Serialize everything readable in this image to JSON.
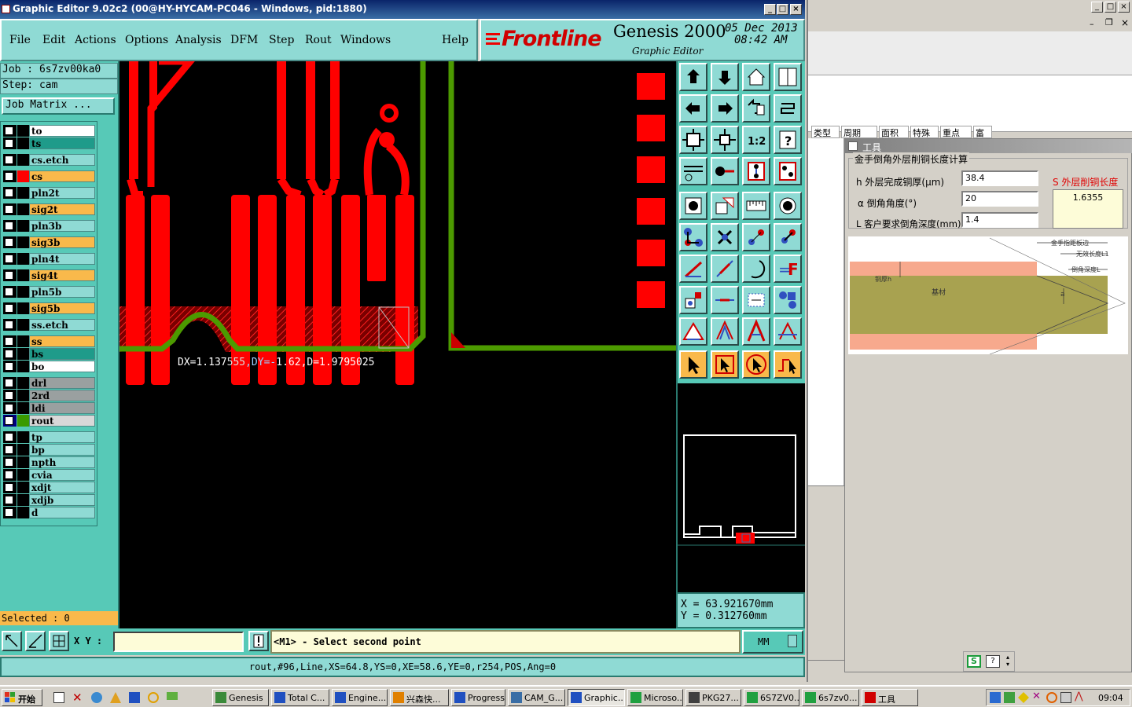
{
  "window": {
    "title": "Graphic Editor 9.02c2 (00@HY-HYCAM-PC046 - Windows, pid:1880)"
  },
  "menu": [
    "File",
    "Edit",
    "Actions",
    "Options",
    "Analysis",
    "DFM",
    "Step",
    "Rout",
    "Windows"
  ],
  "help": "Help",
  "logo": {
    "brand": "Frontline",
    "product": "Genesis 2000",
    "subtitle": "Graphic Editor",
    "date": "05 Dec 2013",
    "time": "08:42  AM"
  },
  "job": {
    "job_label": "Job  :  6s7zv00ka0",
    "step_label": "Step:  cam",
    "matrix_button": "Job Matrix ..."
  },
  "layers": [
    {
      "name": "to",
      "color": "#ffffff"
    },
    {
      "name": "ts",
      "color": "#1f9b8a"
    },
    {
      "name": "cs.etch",
      "color": "#8fdad4"
    },
    {
      "name": "cs",
      "color": "#f9b94b"
    },
    {
      "name": "pln2t",
      "color": "#8fdad4"
    },
    {
      "name": "sig2t",
      "color": "#f9b94b"
    },
    {
      "name": "pln3b",
      "color": "#8fdad4"
    },
    {
      "name": "sig3b",
      "color": "#f9b94b"
    },
    {
      "name": "pln4t",
      "color": "#8fdad4"
    },
    {
      "name": "sig4t",
      "color": "#f9b94b"
    },
    {
      "name": "pln5b",
      "color": "#8fdad4"
    },
    {
      "name": "sig5b",
      "color": "#f9b94b"
    },
    {
      "name": "ss.etch",
      "color": "#8fdad4"
    },
    {
      "name": "ss",
      "color": "#f9b94b"
    },
    {
      "name": "bs",
      "color": "#1f9b8a"
    },
    {
      "name": "bo",
      "color": "#ffffff"
    },
    {
      "name": "drl",
      "color": "#9aa0a0"
    },
    {
      "name": "2rd",
      "color": "#9aa0a0"
    },
    {
      "name": "ldi",
      "color": "#9aa0a0"
    },
    {
      "name": "rout",
      "color": "#d8d8d8"
    },
    {
      "name": "tp",
      "color": "#8fdad4"
    },
    {
      "name": "bp",
      "color": "#8fdad4"
    },
    {
      "name": "npth",
      "color": "#8fdad4"
    },
    {
      "name": "cvia",
      "color": "#8fdad4"
    },
    {
      "name": "xdjt",
      "color": "#8fdad4"
    },
    {
      "name": "xdjb",
      "color": "#8fdad4"
    },
    {
      "name": "d",
      "color": "#8fdad4"
    }
  ],
  "selected": "Selected : 0",
  "canvas": {
    "measure_parts": [
      "DX=1.137",
      "555",
      ",DY=-",
      "1.62",
      ",D=",
      "1.9795025"
    ]
  },
  "coords": {
    "x": "X  =  63.921670mm",
    "y": "Y  =  0.312760mm"
  },
  "bottombar": {
    "xy_label": "X Y :",
    "prompt": "<M1> - Select second point",
    "unit": "MM"
  },
  "status": "rout,#96,Line,XS=64.8,YS=0,XE=58.6,YE=0,r254,POS,Ang=0",
  "rightwin": {
    "tabs": [
      "类型",
      "周期",
      "面积",
      "特殊",
      "重点",
      "富"
    ]
  },
  "tool_dialog": {
    "title": "工具",
    "group": "金手倒角外层削铜长度计算",
    "h_label": "h 外层完成铜厚(μm)",
    "h_value": "38.4",
    "a_label": "α 倒角角度(°)",
    "a_value": "20",
    "L_label": "L 客户要求倒角深度(mm)",
    "L_value": "1.4",
    "s_label": "S 外层削铜长度",
    "s_value": "1.6355",
    "diagram": {
      "label_gold_edge": "金手指距板边",
      "label_invalid_len": "无效长度L1",
      "label_bevel_depth": "倒角深度L",
      "label_cu_thick": "铜厚h",
      "label_base": "基材",
      "label_alpha": "a"
    }
  },
  "taskbar": {
    "start": "开始",
    "tasks": [
      "Genesis",
      "Total C...",
      "Engine...",
      "兴森快...",
      "Progress",
      "CAM_G...",
      "Graphic...",
      "Microso...",
      "PKG27...",
      "6S7ZV0...",
      "6s7zv0...",
      "工具"
    ],
    "clock": "09:04"
  },
  "colors": {
    "teal": "#57c9b7",
    "light_teal": "#8fdad4",
    "orange": "#f9b94b",
    "copper_red": "#ff0000",
    "rout_green": "#4c9a00"
  }
}
